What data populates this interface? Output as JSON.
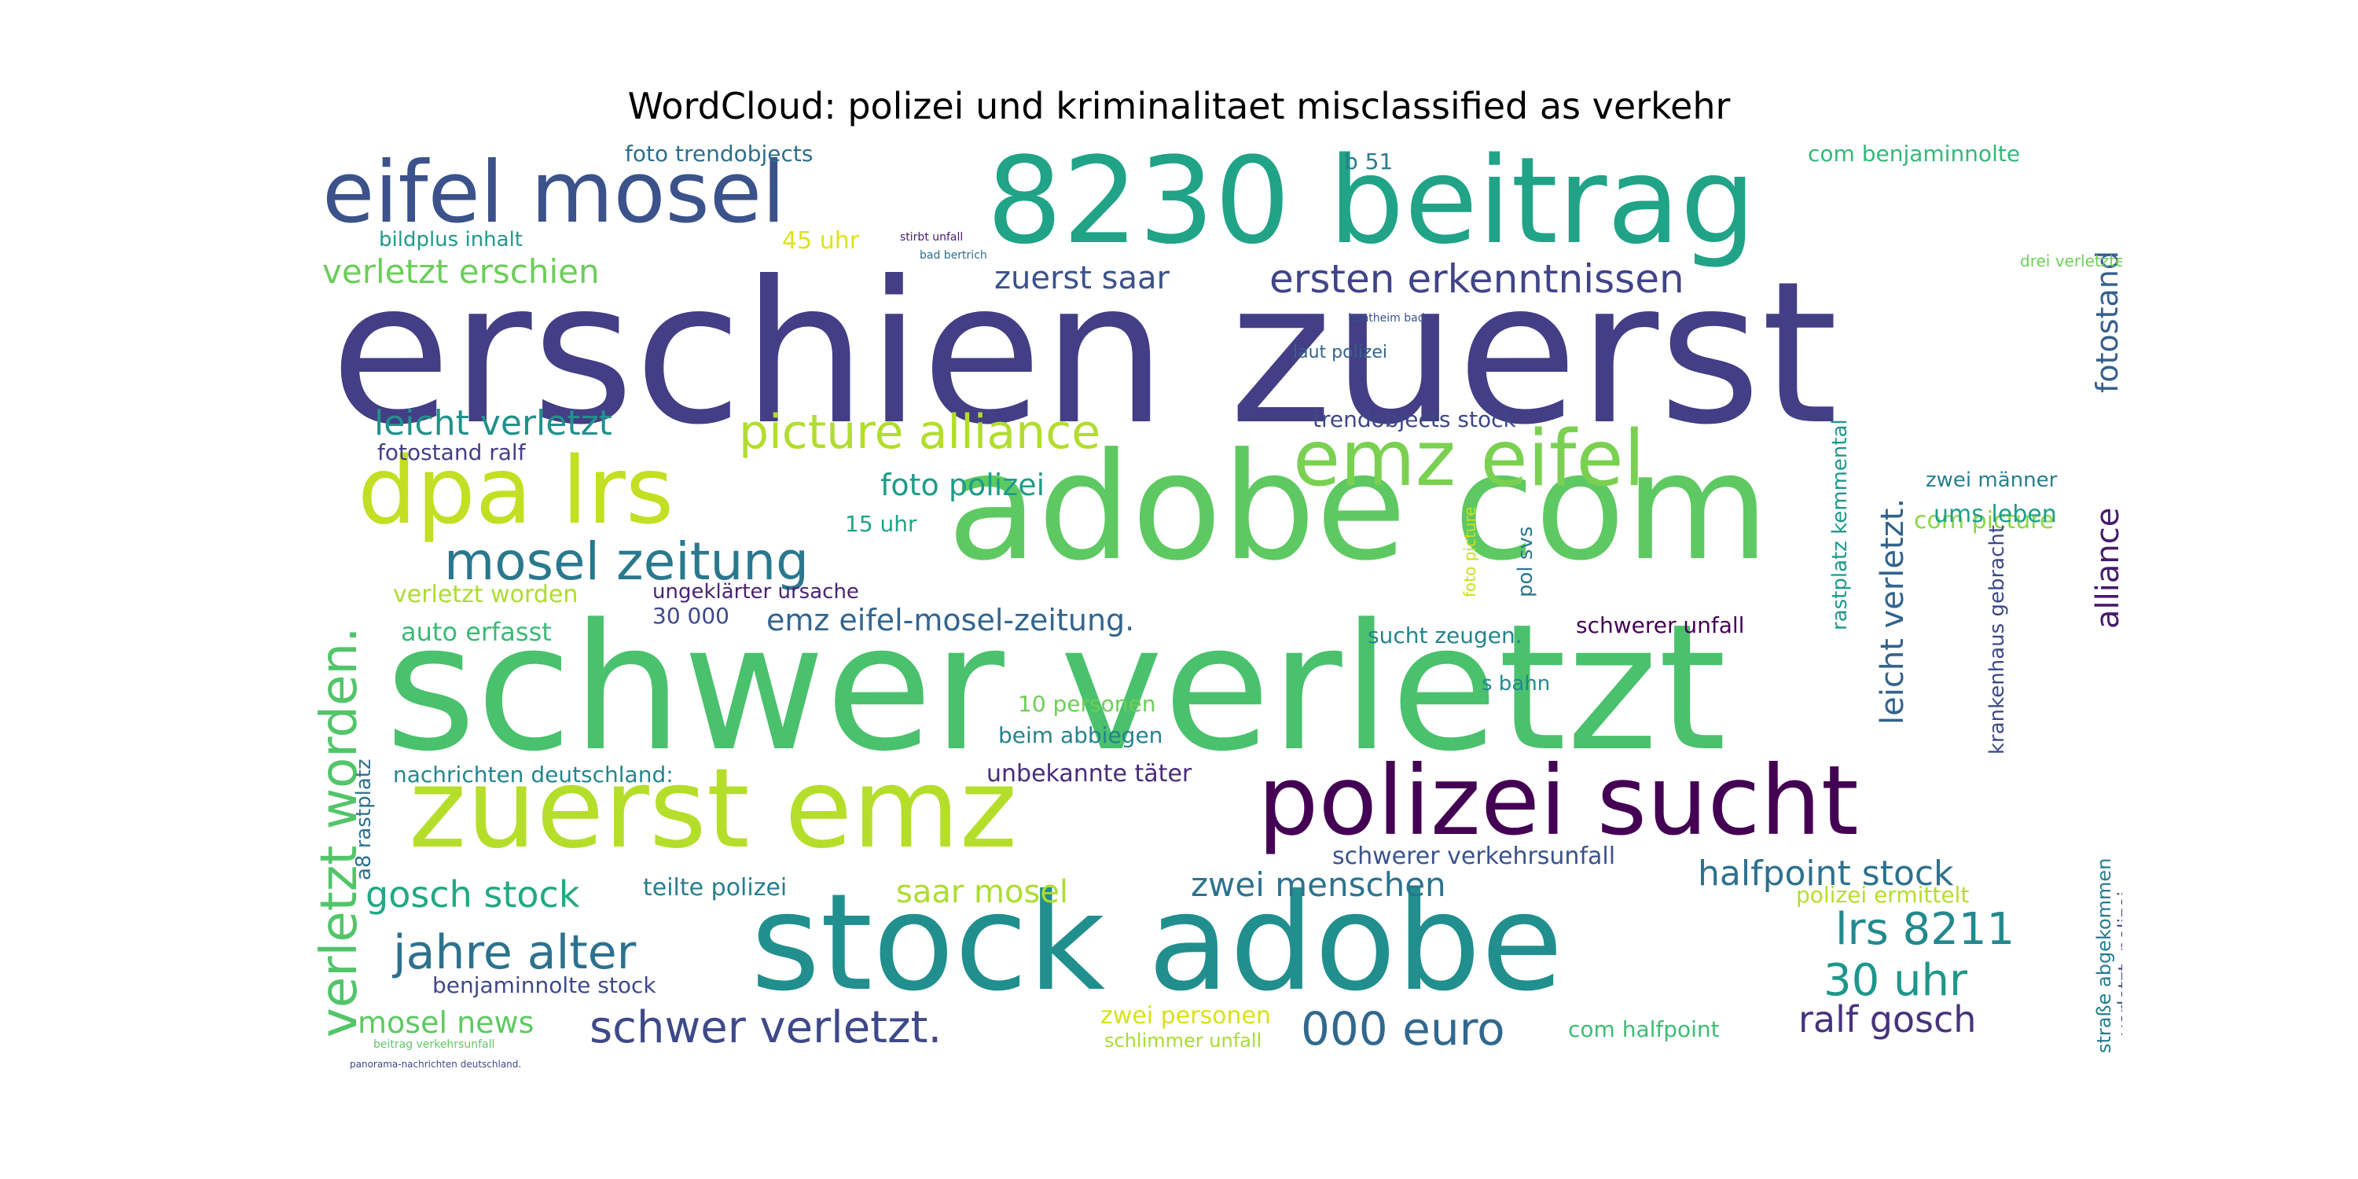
{
  "title": "WordCloud: polizei und kriminalitaet misclassified as verkehr",
  "words": [
    {
      "text": "erschien zuerst",
      "color": "#433e85"
    },
    {
      "text": "schwer verletzt",
      "color": "#4ac16d"
    },
    {
      "text": "adobe com",
      "color": "#5ec962"
    },
    {
      "text": "stock adobe",
      "color": "#218f8d"
    },
    {
      "text": "8230 beitrag",
      "color": "#20a386"
    },
    {
      "text": "zuerst emz",
      "color": "#b5de2b"
    },
    {
      "text": "polizei sucht",
      "color": "#440154"
    },
    {
      "text": "eifel mosel",
      "color": "#3b528b"
    },
    {
      "text": "dpa lrs",
      "color": "#c2df23"
    },
    {
      "text": "emz eifel",
      "color": "#7ad151"
    },
    {
      "text": "verletzt worden.",
      "color": "#52c569"
    },
    {
      "text": "mosel zeitung",
      "color": "#2a788e"
    },
    {
      "text": "picture alliance",
      "color": "#b2dd2d"
    },
    {
      "text": "jahre alter",
      "color": "#2c728e"
    },
    {
      "text": "schwer verletzt.",
      "color": "#3e4989"
    },
    {
      "text": "ersten erkenntnissen",
      "color": "#414487"
    },
    {
      "text": "verletzt erschien",
      "color": "#6ccd5a"
    },
    {
      "text": "emz eifel-mosel-zeitung.",
      "color": "#32658e"
    },
    {
      "text": "30 uhr",
      "color": "#1f968b"
    },
    {
      "text": "000 euro",
      "color": "#31688e"
    },
    {
      "text": "lrs 8211",
      "color": "#23898e"
    },
    {
      "text": "halfpoint stock",
      "color": "#2d718e"
    },
    {
      "text": "gosch stock",
      "color": "#22a884"
    },
    {
      "text": "zwei menschen",
      "color": "#2c738e"
    },
    {
      "text": "saar mosel",
      "color": "#addc30"
    },
    {
      "text": "ralf gosch",
      "color": "#46337e"
    },
    {
      "text": "leicht verletzt",
      "color": "#21918c"
    },
    {
      "text": "zuerst saar",
      "color": "#3b528b"
    },
    {
      "text": "foto polizei",
      "color": "#1e9c89"
    },
    {
      "text": "fotostand",
      "color": "#355f8d"
    },
    {
      "text": "alliance",
      "color": "#481a6c"
    },
    {
      "text": "leicht verletzt.",
      "color": "#33638d"
    },
    {
      "text": "mosel news",
      "color": "#5ec962"
    },
    {
      "text": "auto erfasst",
      "color": "#3aba76"
    },
    {
      "text": "verletzt worden",
      "color": "#addc30"
    },
    {
      "text": "com picture",
      "color": "#8bd646"
    },
    {
      "text": "ums leben",
      "color": "#1f9e89"
    },
    {
      "text": "teilte polizei",
      "color": "#287d8e"
    },
    {
      "text": "unbekannte täter",
      "color": "#472c7a"
    },
    {
      "text": "beim abbiegen",
      "color": "#26828e"
    },
    {
      "text": "schwerer verkehrsunfall",
      "color": "#3b528b"
    },
    {
      "text": "polizei ermittelt",
      "color": "#b5de2b"
    },
    {
      "text": "nachrichten deutschland:",
      "color": "#24868e"
    },
    {
      "text": "benjaminnolte stock",
      "color": "#3e4989"
    },
    {
      "text": "zwei personen",
      "color": "#d8e219"
    },
    {
      "text": "com halfpoint",
      "color": "#3dbc74"
    },
    {
      "text": "fotostand ralf",
      "color": "#424086"
    },
    {
      "text": "trendobjects stock",
      "color": "#3f4788"
    },
    {
      "text": "foto trendobjects",
      "color": "#2e6e8e"
    },
    {
      "text": "bildplus inhalt",
      "color": "#1f9a8a"
    },
    {
      "text": "com benjaminnolte",
      "color": "#35b779"
    },
    {
      "text": "45 uhr",
      "color": "#dde318"
    },
    {
      "text": "15 uhr",
      "color": "#20a386"
    },
    {
      "text": "30 000",
      "color": "#3e4989"
    },
    {
      "text": "ungeklärter ursache",
      "color": "#482475"
    },
    {
      "text": "10 personen",
      "color": "#6ece58"
    },
    {
      "text": "sucht zeugen.",
      "color": "#25838e"
    },
    {
      "text": "schwerer unfall",
      "color": "#440154"
    },
    {
      "text": "s bahn",
      "color": "#23898e"
    },
    {
      "text": "zwei männer",
      "color": "#277f8e"
    },
    {
      "text": "krankenhaus gebracht",
      "color": "#3e4989"
    },
    {
      "text": "rastplatz kemmental",
      "color": "#1f988b"
    },
    {
      "text": "straße abgekommen",
      "color": "#287c8e"
    },
    {
      "text": "verletzt. polizei",
      "color": "#3f4788"
    },
    {
      "text": "a8 rastplatz",
      "color": "#2d708e"
    },
    {
      "text": "pol svs",
      "color": "#2a788e"
    },
    {
      "text": "laut polizei",
      "color": "#33638d"
    },
    {
      "text": "schlimmer unfall",
      "color": "#a8db34"
    },
    {
      "text": "b 51",
      "color": "#287d8e"
    },
    {
      "text": "foto picture",
      "color": "#c8e020"
    },
    {
      "text": "bad bertrich",
      "color": "#2e6e8e"
    },
    {
      "text": "stirbt unfall",
      "color": "#481a6c"
    },
    {
      "text": "hontheim bad",
      "color": "#3b528b"
    },
    {
      "text": "beitrag verkehrsunfall",
      "color": "#5ec962"
    },
    {
      "text": "panorama-nachrichten deutschland.",
      "color": "#3e4989"
    },
    {
      "text": "drei verletzte",
      "color": "#6ece58"
    }
  ]
}
